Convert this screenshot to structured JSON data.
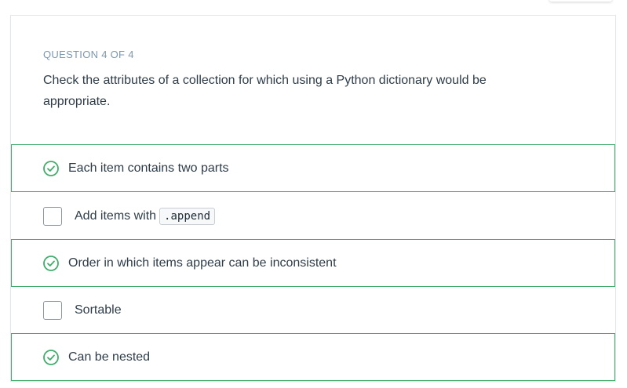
{
  "quiz": {
    "progress_label": "QUESTION 4 OF 4",
    "prompt": "Check the attributes of a collection for which using a Python dictionary would be appropriate.",
    "options": [
      {
        "label": "Each item contains two parts",
        "state": "correct"
      },
      {
        "label": "Add items with",
        "code": ".append",
        "state": "unchecked"
      },
      {
        "label": "Order in which items appear can be inconsistent",
        "state": "correct"
      },
      {
        "label": "Sortable",
        "state": "unchecked"
      },
      {
        "label": "Can be nested",
        "state": "correct"
      }
    ]
  },
  "colors": {
    "correct": "#41ac6b",
    "text": "#2e3d49",
    "muted": "#7d97ad"
  },
  "icons": {
    "correct": "check-circle-icon",
    "unchecked": "checkbox"
  }
}
